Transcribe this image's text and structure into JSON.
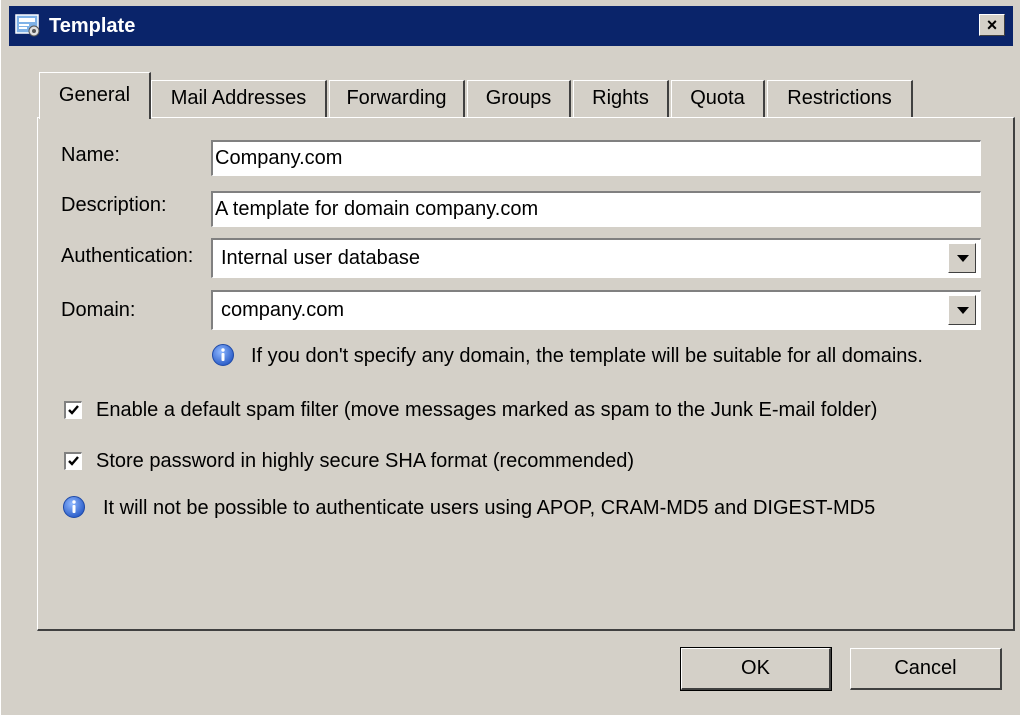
{
  "window": {
    "title": "Template",
    "close_label": "×"
  },
  "tabs": [
    {
      "label": "General",
      "active": true
    },
    {
      "label": "Mail Addresses",
      "active": false
    },
    {
      "label": "Forwarding",
      "active": false
    },
    {
      "label": "Groups",
      "active": false
    },
    {
      "label": "Rights",
      "active": false
    },
    {
      "label": "Quota",
      "active": false
    },
    {
      "label": "Restrictions",
      "active": false
    }
  ],
  "form": {
    "name_label": "Name:",
    "name_value": "Company.com",
    "description_label": "Description:",
    "description_value": "A template for domain company.com",
    "authentication_label": "Authentication:",
    "authentication_value": "Internal user database",
    "domain_label": "Domain:",
    "domain_value": "company.com",
    "domain_info": "If you don't specify any domain, the template will be suitable for all domains.",
    "spam_filter_label": "Enable a default spam filter (move messages marked as spam to the Junk E-mail folder)",
    "spam_filter_checked": true,
    "sha_label": "Store password in highly secure SHA format (recommended)",
    "sha_checked": true,
    "sha_info": "It will not be possible to authenticate users using APOP, CRAM-MD5 and DIGEST-MD5"
  },
  "buttons": {
    "ok": "OK",
    "cancel": "Cancel"
  },
  "icons": {
    "app": "template-app-icon",
    "info": "info-icon",
    "close": "close-icon"
  },
  "colors": {
    "titlebar": "#0a246a",
    "face": "#d4d0c8",
    "info_blue": "#3a6fd8"
  }
}
